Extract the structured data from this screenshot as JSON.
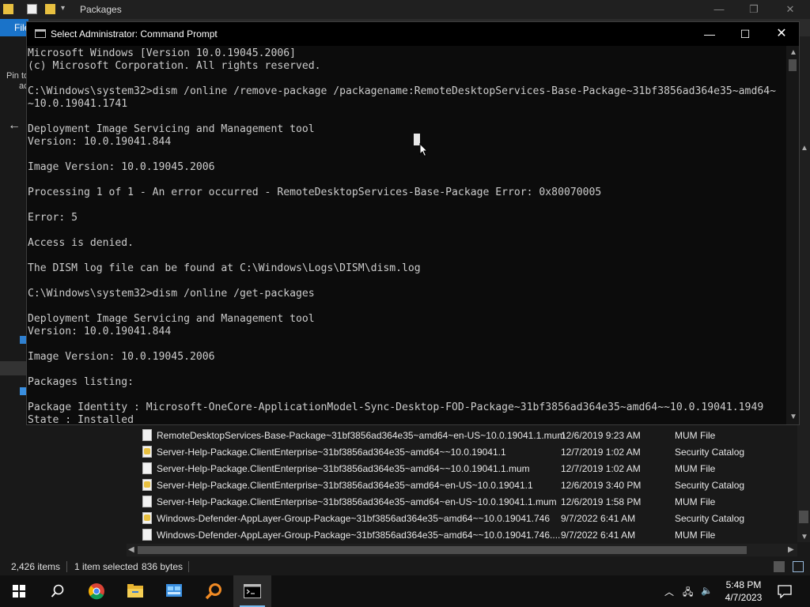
{
  "explorer": {
    "title": "Packages",
    "file_tab": "File",
    "left_peek": [
      "Pin to",
      "ac"
    ],
    "files": [
      {
        "name": "RemoteDesktopServices-Base-Package~31bf3856ad364e35~amd64~en-US~10.0.19041.1.mum",
        "date": "12/6/2019 9:23 AM",
        "type": "MUM File",
        "icon": "mum-file-icon"
      },
      {
        "name": "Server-Help-Package.ClientEnterprise~31bf3856ad364e35~amd64~~10.0.19041.1",
        "date": "12/7/2019 1:02 AM",
        "type": "Security Catalog",
        "icon": "security-catalog-icon"
      },
      {
        "name": "Server-Help-Package.ClientEnterprise~31bf3856ad364e35~amd64~~10.0.19041.1.mum",
        "date": "12/7/2019 1:02 AM",
        "type": "MUM File",
        "icon": "mum-file-icon"
      },
      {
        "name": "Server-Help-Package.ClientEnterprise~31bf3856ad364e35~amd64~en-US~10.0.19041.1",
        "date": "12/6/2019 3:40 PM",
        "type": "Security Catalog",
        "icon": "security-catalog-icon"
      },
      {
        "name": "Server-Help-Package.ClientEnterprise~31bf3856ad364e35~amd64~en-US~10.0.19041.1.mum",
        "date": "12/6/2019 1:58 PM",
        "type": "MUM File",
        "icon": "mum-file-icon"
      },
      {
        "name": "Windows-Defender-AppLayer-Group-Package~31bf3856ad364e35~amd64~~10.0.19041.746",
        "date": "9/7/2022 6:41 AM",
        "type": "Security Catalog",
        "icon": "security-catalog-icon"
      },
      {
        "name": "Windows-Defender-AppLayer-Group-Package~31bf3856ad364e35~amd64~~10.0.19041.746....",
        "date": "9/7/2022 6:41 AM",
        "type": "MUM File",
        "icon": "mum-file-icon"
      }
    ],
    "status": {
      "items": "2,426 items",
      "selected": "1 item selected",
      "size": "836 bytes"
    }
  },
  "cmd": {
    "title": "Select Administrator: Command Prompt",
    "lines": [
      "Microsoft Windows [Version 10.0.19045.2006]",
      "(c) Microsoft Corporation. All rights reserved.",
      "",
      "C:\\Windows\\system32>dism /online /remove-package /packagename:RemoteDesktopServices-Base-Package~31bf3856ad364e35~amd64~",
      "~10.0.19041.1741",
      "",
      "Deployment Image Servicing and Management tool",
      "Version: 10.0.19041.844",
      "",
      "Image Version: 10.0.19045.2006",
      "",
      "Processing 1 of 1 - An error occurred - RemoteDesktopServices-Base-Package Error: 0x80070005",
      "",
      "Error: 5",
      "",
      "Access is denied.",
      "",
      "The DISM log file can be found at C:\\Windows\\Logs\\DISM\\dism.log",
      "",
      "C:\\Windows\\system32>dism /online /get-packages",
      "",
      "Deployment Image Servicing and Management tool",
      "Version: 10.0.19041.844",
      "",
      "Image Version: 10.0.19045.2006",
      "",
      "Packages listing:",
      "",
      "Package Identity : Microsoft-OneCore-ApplicationModel-Sync-Desktop-FOD-Package~31bf3856ad364e35~amd64~~10.0.19041.1949",
      "State : Installed"
    ]
  },
  "taskbar": {
    "time": "5:48 PM",
    "date": "4/7/2023",
    "pins": [
      "start-icon",
      "search-icon",
      "chrome-icon",
      "file-explorer-icon",
      "control-panel-icon",
      "search-app-icon",
      "command-prompt-icon"
    ]
  }
}
